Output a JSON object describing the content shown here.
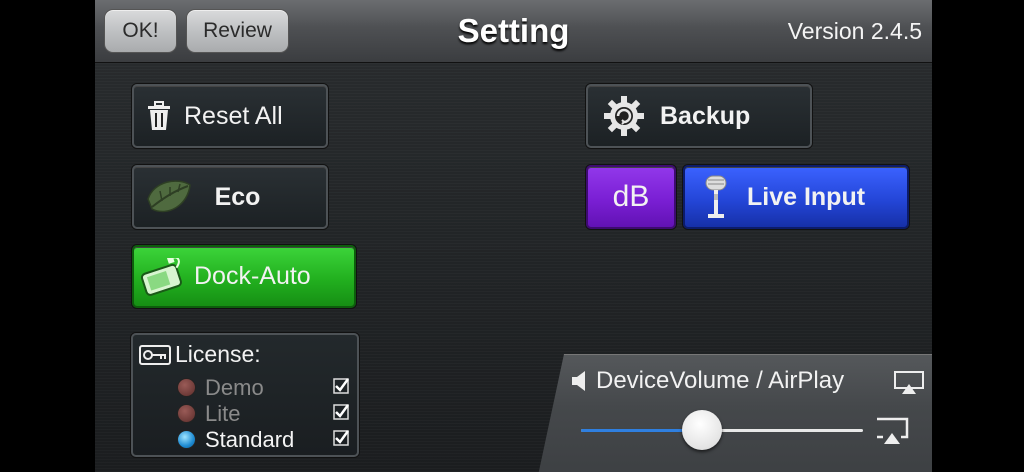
{
  "topbar": {
    "ok_label": "OK!",
    "review_label": "Review",
    "title": "Setting",
    "version": "Version 2.4.5"
  },
  "buttons": {
    "reset_all": "Reset All",
    "eco": "Eco",
    "dock_auto": "Dock-Auto",
    "backup": "Backup",
    "db": "dB",
    "live_input": "Live Input"
  },
  "license": {
    "title": "License:",
    "options": [
      {
        "label": "Demo",
        "selected": false
      },
      {
        "label": "Lite",
        "selected": false
      },
      {
        "label": "Standard",
        "selected": true
      }
    ]
  },
  "volume": {
    "title": "DeviceVolume / AirPlay",
    "level": 0.43
  },
  "colors": {
    "dock_green": "#22b01f",
    "db_purple": "#7a1fd4",
    "live_blue": "#2446d8",
    "slider_fill": "#2f7fe0"
  },
  "icons": [
    "trash-icon",
    "leaf-icon",
    "dock-icon",
    "gear-icon",
    "microphone-icon",
    "key-icon",
    "speaker-icon",
    "airplay-icon",
    "checkmark-icon"
  ]
}
